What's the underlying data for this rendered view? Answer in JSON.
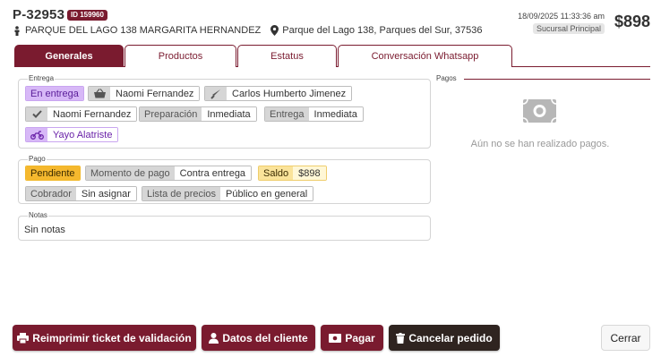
{
  "header": {
    "order_id": "P-32953",
    "id_badge": "ID 159960",
    "customer_address": "PARQUE DEL LAGO 138 MARGARITA HERNANDEZ",
    "location": "Parque del Lago 138, Parques del Sur, 37536",
    "datetime": "18/09/2025 11:33:36 am",
    "branch": "Sucursal Principal",
    "total": "$898"
  },
  "tabs": [
    {
      "label": "Generales",
      "active": true
    },
    {
      "label": "Productos"
    },
    {
      "label": "Estatus"
    },
    {
      "label": "Conversación Whatsapp"
    }
  ],
  "entrega": {
    "legend": "Entrega",
    "status": "En entrega",
    "seller": "Naomi Fernandez",
    "preparer": "Carlos Humberto Jimenez",
    "checker": "Naomi Fernandez",
    "preparacion_label": "Preparación",
    "preparacion_value": "Inmediata",
    "entrega_label": "Entrega",
    "entrega_value": "Inmediata",
    "driver": "Yayo Alatriste"
  },
  "pago": {
    "legend": "Pago",
    "status": "Pendiente",
    "momento_label": "Momento de pago",
    "momento_value": "Contra entrega",
    "saldo_label": "Saldo",
    "saldo_value": "$898",
    "cobrador_label": "Cobrador",
    "cobrador_value": "Sin asignar",
    "lista_label": "Lista de precios",
    "lista_value": "Público en general"
  },
  "notas": {
    "legend": "Notas",
    "text": "Sin notas"
  },
  "pagos": {
    "title": "Pagos",
    "empty_text": "Aún no se han realizado pagos."
  },
  "buttons": {
    "reprint": "Reimprimir ticket de validación",
    "client": "Datos del cliente",
    "pay": "Pagar",
    "cancel": "Cancelar pedido",
    "close": "Cerrar"
  },
  "colors": {
    "brand": "#7a1b2f",
    "dark": "#2f2420",
    "purple": "#d7b8f7",
    "orange": "#f5b82e",
    "yellow": "#fae39a"
  }
}
